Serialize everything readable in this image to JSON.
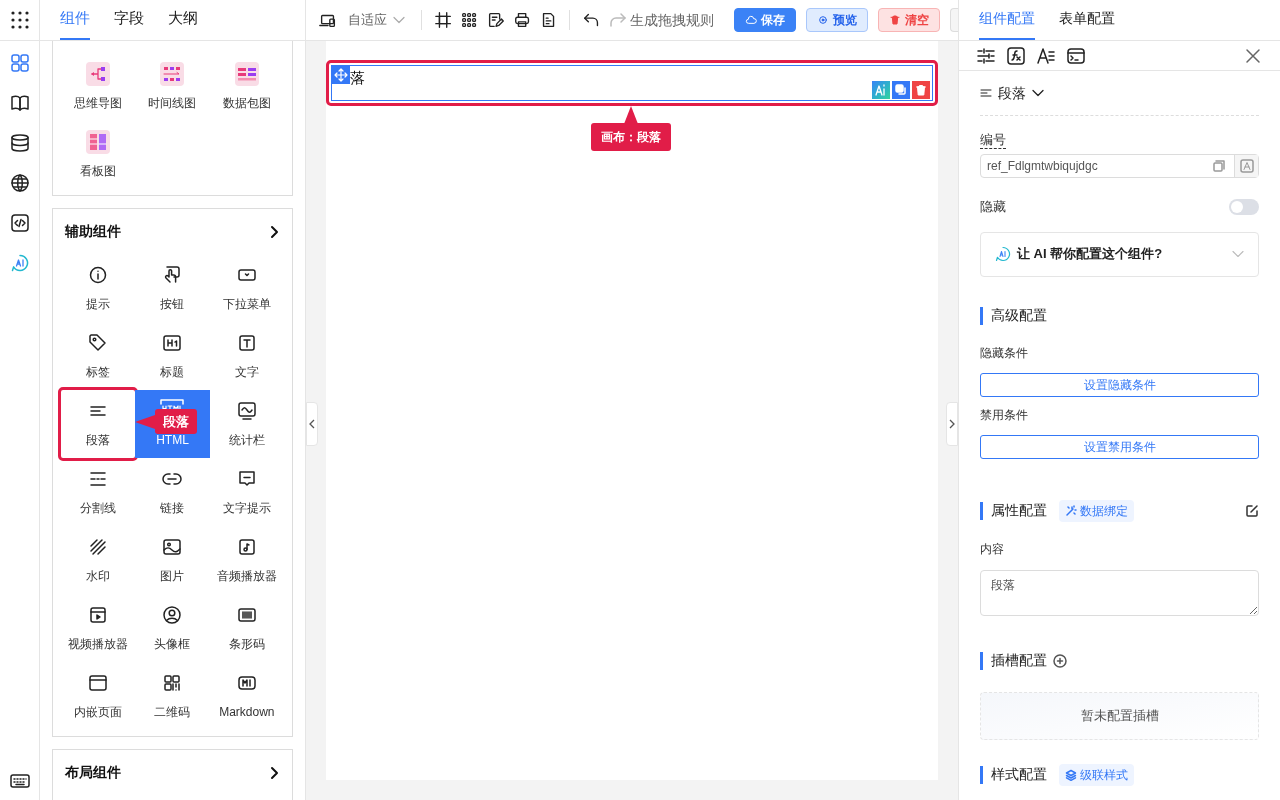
{
  "rail": [
    {
      "selected": true
    },
    {
      "selected": false
    },
    {
      "selected": false
    },
    {
      "selected": false
    },
    {
      "selected": false
    },
    {
      "selected": false
    }
  ],
  "left_tabs": [
    {
      "label": "组件",
      "selected": true
    },
    {
      "label": "字段",
      "selected": false
    },
    {
      "label": "大纲",
      "selected": false
    }
  ],
  "groups": [
    {
      "items": [
        {
          "label": "思维导图",
          "selected": false
        },
        {
          "label": "时间线图",
          "selected": false
        },
        {
          "label": "数据包图",
          "selected": false
        },
        {
          "label": "看板图",
          "selected": false
        }
      ]
    },
    {
      "title": "辅助组件",
      "items": [
        {
          "label": "提示",
          "selected": false
        },
        {
          "label": "按钮",
          "selected": false
        },
        {
          "label": "下拉菜单",
          "selected": false
        },
        {
          "label": "标签",
          "selected": false
        },
        {
          "label": "标题",
          "selected": false
        },
        {
          "label": "文字",
          "selected": false
        },
        {
          "label": "段落",
          "selected": false,
          "callout": "段落"
        },
        {
          "label": "HTML",
          "selected": true
        },
        {
          "label": "统计栏",
          "selected": false
        },
        {
          "label": "分割线",
          "selected": false
        },
        {
          "label": "链接",
          "selected": false
        },
        {
          "label": "文字提示",
          "selected": false
        },
        {
          "label": "水印",
          "selected": false
        },
        {
          "label": "图片",
          "selected": false
        },
        {
          "label": "音频播放器",
          "selected": false
        },
        {
          "label": "视频播放器",
          "selected": false
        },
        {
          "label": "头像框",
          "selected": false
        },
        {
          "label": "条形码",
          "selected": false
        },
        {
          "label": "内嵌页面",
          "selected": false
        },
        {
          "label": "二维码",
          "selected": false
        },
        {
          "label": "Markdown",
          "selected": false
        }
      ]
    },
    {
      "title": "布局组件"
    }
  ],
  "toolbar": {
    "mode": "自适应",
    "rule_button": "生成拖拽规则",
    "buttons": [
      {
        "kind": "primary",
        "label": "保存"
      },
      {
        "kind": "info",
        "label": "预览"
      },
      {
        "kind": "danger",
        "label": "清空"
      }
    ]
  },
  "canvas": {
    "element_text": "落",
    "callout": "画布：段落"
  },
  "right_tabs": [
    {
      "label": "组件配置",
      "selected": true
    },
    {
      "label": "表单配置",
      "selected": false
    }
  ],
  "component": {
    "type": "段落",
    "id_label": "编号",
    "id_value": "ref_Fdlgmtwbiqujdgc",
    "hidden_label": "隐藏",
    "hidden_on": false,
    "ai_prompt": "让 AI 帮你配置这个组件?"
  },
  "advanced": {
    "title": "高级配置",
    "hide_label": "隐藏条件",
    "hide_button": "设置隐藏条件",
    "disable_label": "禁用条件",
    "disable_button": "设置禁用条件"
  },
  "props": {
    "title": "属性配置",
    "tag": "数据绑定",
    "content_label": "内容",
    "content_value": "段落"
  },
  "slots": {
    "title": "插槽配置",
    "empty": "暂未配置插槽"
  },
  "style": {
    "title": "样式配置",
    "tag": "级联样式"
  }
}
